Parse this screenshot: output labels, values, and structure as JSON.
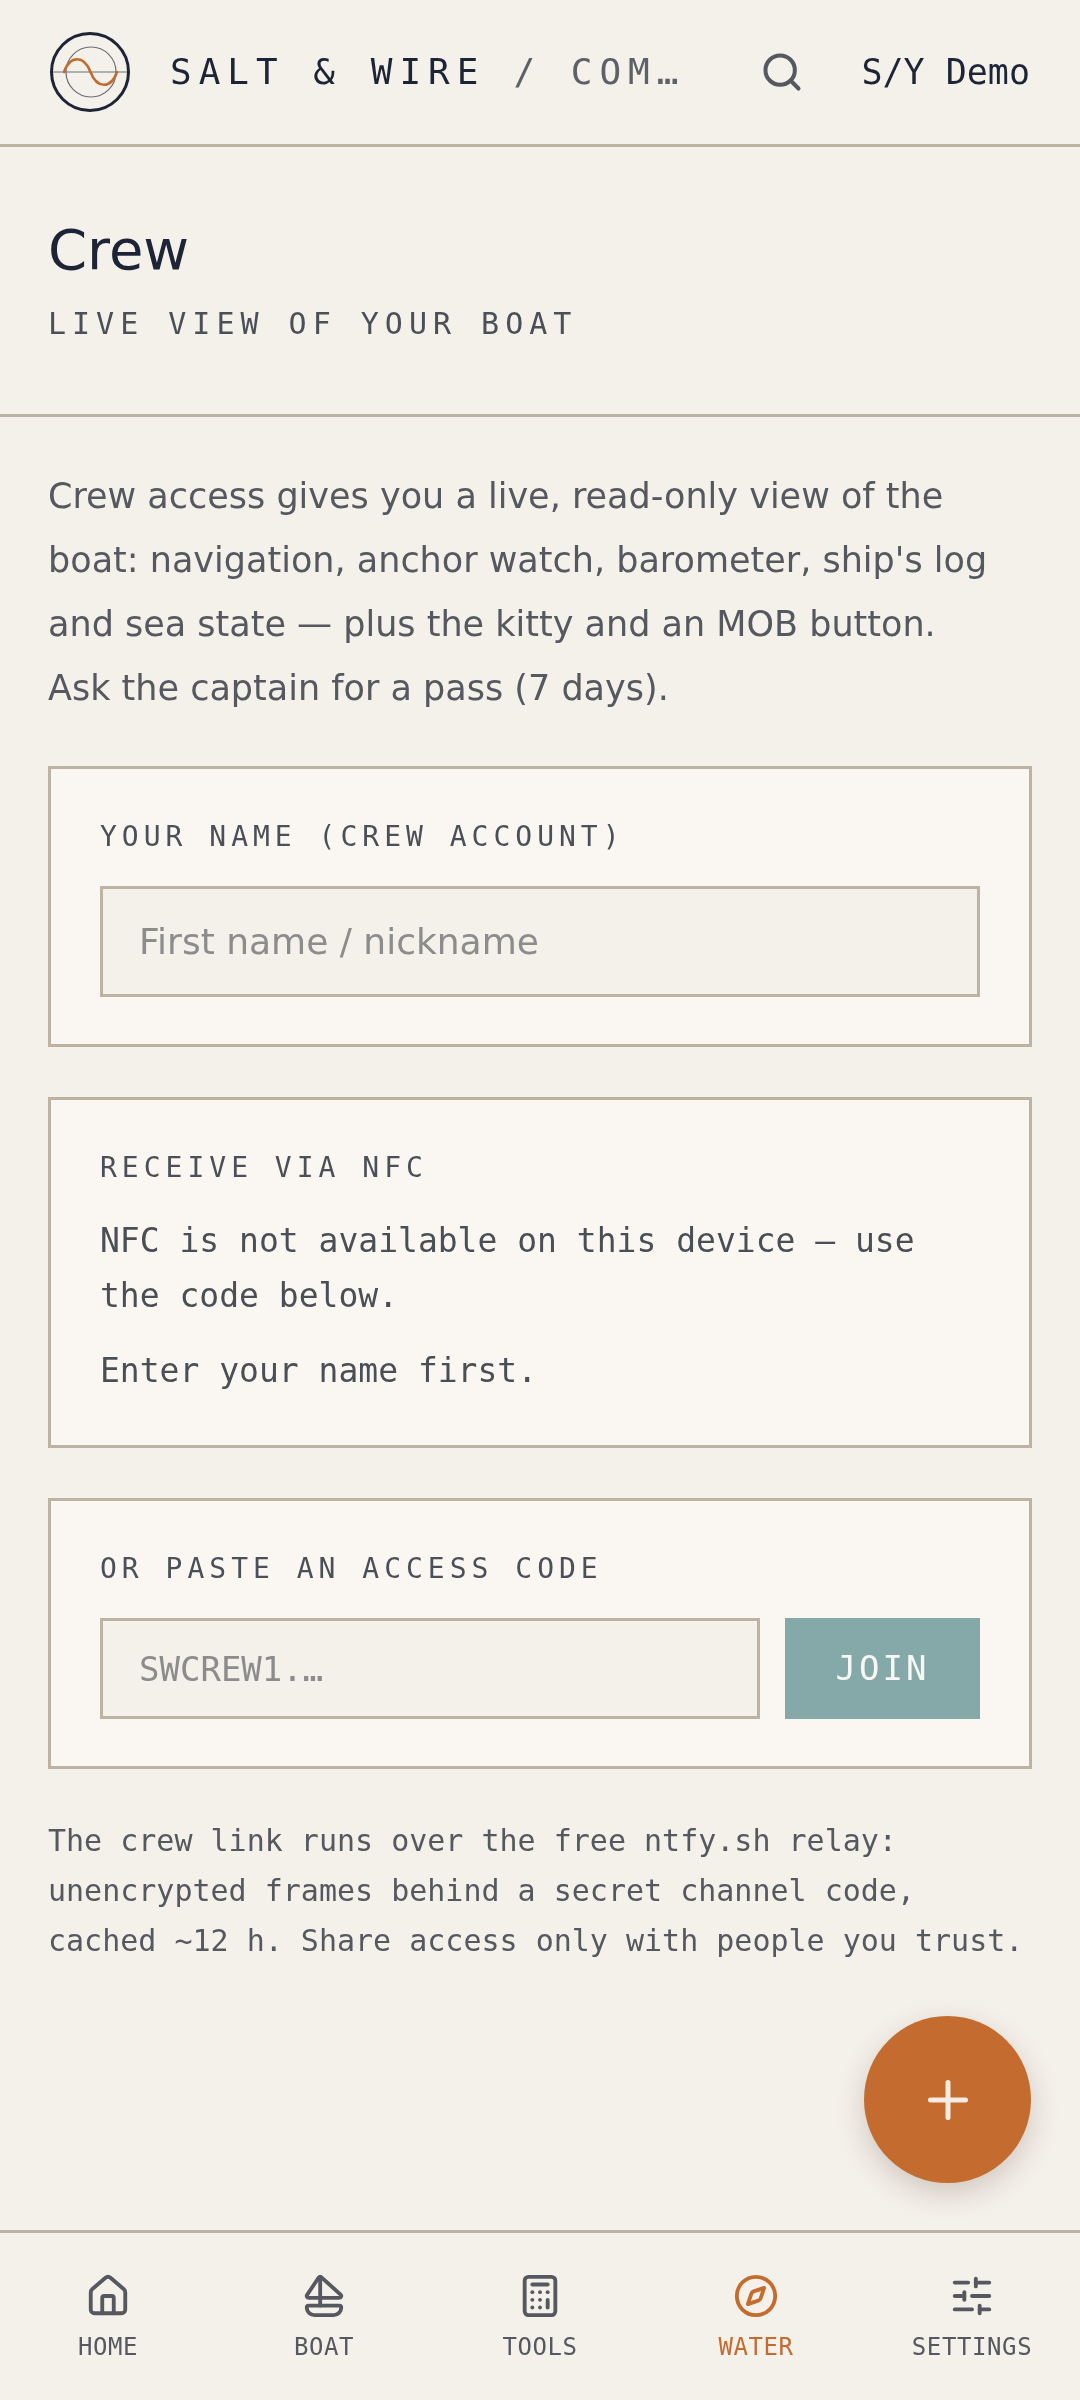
{
  "header": {
    "brand": "SALT & WIRE",
    "section": "/ COM…",
    "vessel": "S/Y Demo"
  },
  "page": {
    "title": "Crew",
    "subtitle": "LIVE VIEW OF YOUR BOAT"
  },
  "intro": "Crew access gives you a live, read-only view of the boat: navigation, anchor watch, barometer, ship's log and sea state — plus the kitty and an MOB button. Ask the captain for a pass (7 days).",
  "cards": [
    {
      "kind": "name",
      "label": "YOUR NAME (CREW ACCOUNT)",
      "field": {
        "placeholder": "First name / nickname"
      }
    },
    {
      "kind": "info",
      "label": "RECEIVE VIA NFC",
      "paragraphs": [
        "NFC is not available on this device — use the code below.",
        "Enter your name first."
      ]
    },
    {
      "kind": "code",
      "label": "OR PASTE AN ACCESS CODE",
      "field": {
        "placeholder": "SWCREW1.…"
      },
      "button": "JOIN"
    }
  ],
  "note": "The crew link runs over the free ntfy.sh relay: unencrypted frames behind a secret channel code, cached ~12 h. Share access only with people you trust.",
  "nav": [
    {
      "kind": "home",
      "label": "HOME",
      "selected": false
    },
    {
      "kind": "boat",
      "label": "BOAT",
      "selected": false
    },
    {
      "kind": "tools",
      "label": "TOOLS",
      "selected": false
    },
    {
      "kind": "water",
      "label": "WATER",
      "selected": true
    },
    {
      "kind": "settings",
      "label": "SETTINGS",
      "selected": false
    }
  ]
}
